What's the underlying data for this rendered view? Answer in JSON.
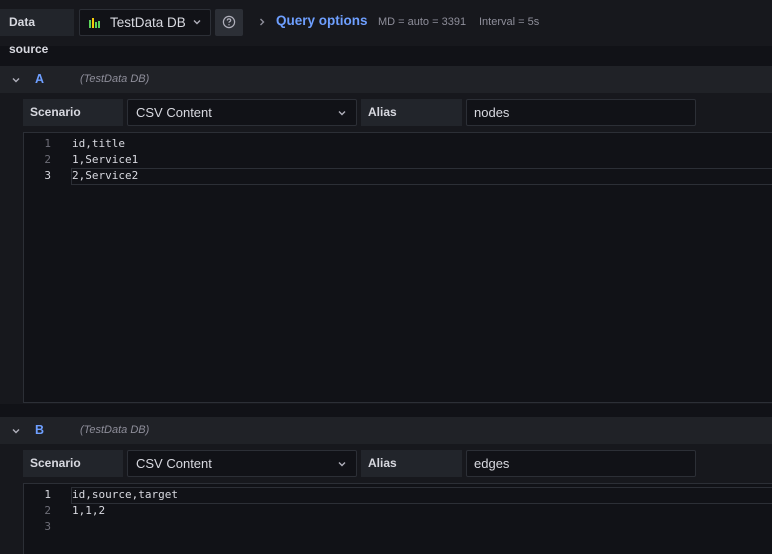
{
  "toolbar": {
    "data_source_label": "Data source",
    "datasource_name": "TestData DB",
    "query_options_label": "Query options",
    "md_info": "MD = auto = 3391",
    "interval_info": "Interval = 5s"
  },
  "accent_color": "#6e9fff",
  "queries": [
    {
      "ref_id": "A",
      "datasource": "(TestData DB)",
      "scenario_label": "Scenario",
      "scenario_value": "CSV Content",
      "alias_label": "Alias",
      "alias_value": "nodes",
      "lines": [
        {
          "num": "1",
          "text": "id,title"
        },
        {
          "num": "2",
          "text": "1,Service1"
        },
        {
          "num": "3",
          "text": "2,Service2"
        }
      ],
      "active_line": 3
    },
    {
      "ref_id": "B",
      "datasource": "(TestData DB)",
      "scenario_label": "Scenario",
      "scenario_value": "CSV Content",
      "alias_label": "Alias",
      "alias_value": "edges",
      "lines": [
        {
          "num": "1",
          "text": "id,source,target"
        },
        {
          "num": "2",
          "text": "1,1,2"
        },
        {
          "num": "3",
          "text": ""
        }
      ],
      "active_line": 1
    }
  ]
}
